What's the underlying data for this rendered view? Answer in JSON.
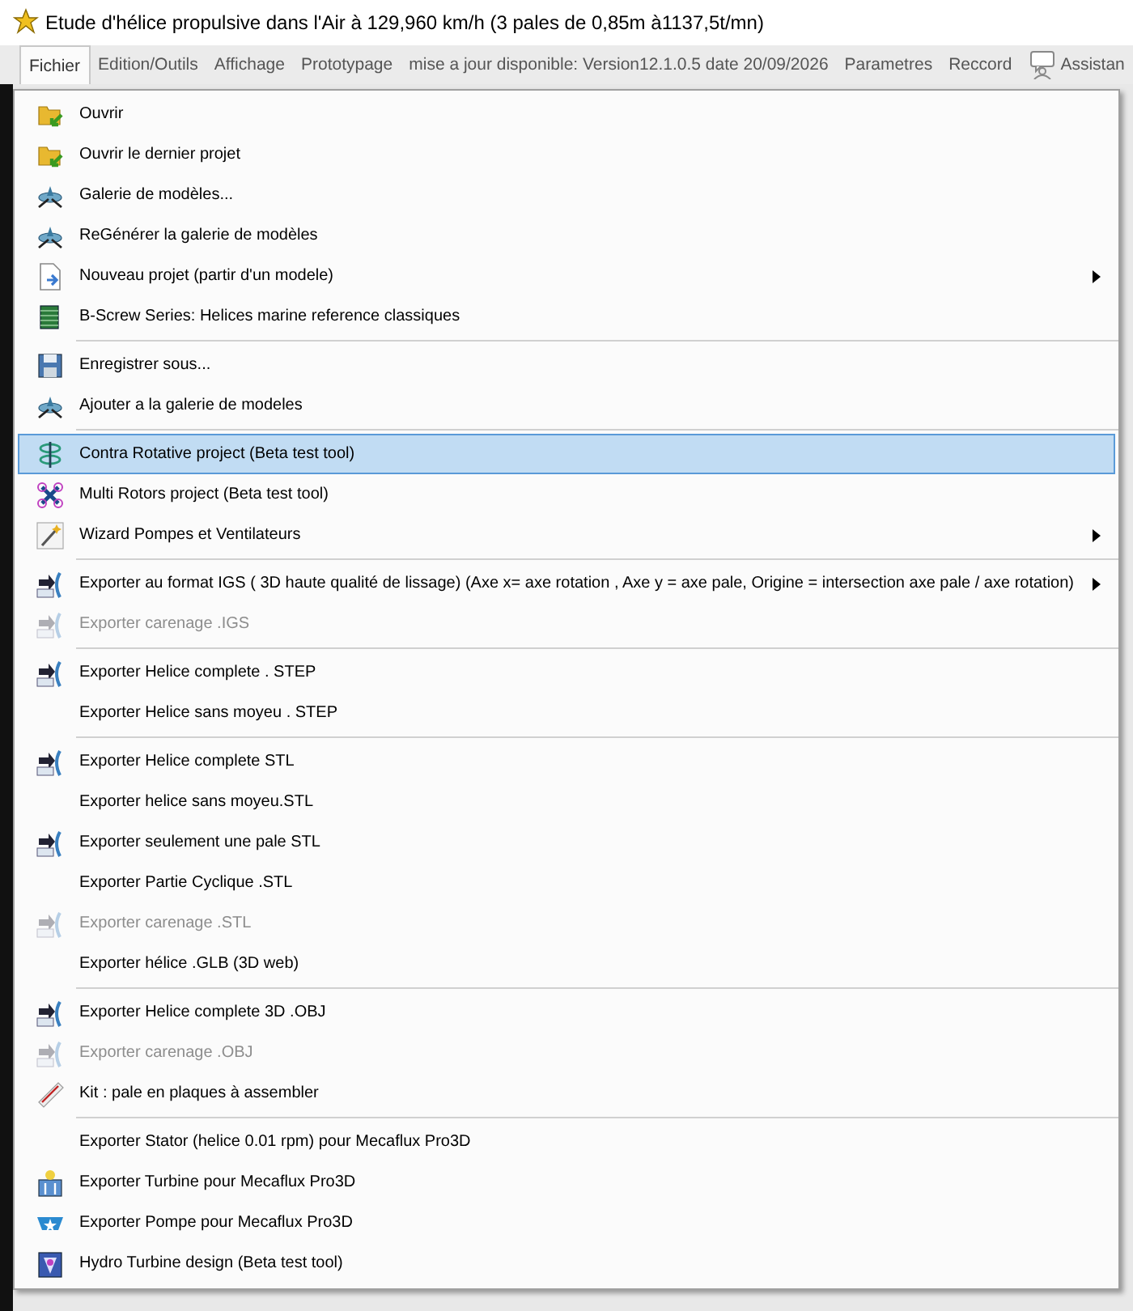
{
  "window": {
    "title": "Etude d'hélice propulsive dans l'Air à 129,960 km/h (3 pales de 0,85m à1137,5t/mn)"
  },
  "menubar": [
    {
      "label": "Fichier",
      "selected": true
    },
    {
      "label": "Edition/Outils",
      "selected": false
    },
    {
      "label": "Affichage",
      "selected": false
    },
    {
      "label": "Prototypage",
      "selected": false
    },
    {
      "label": "mise a jour disponible: Version12.1.0.5 date 20/09/2026",
      "selected": false
    },
    {
      "label": "Parametres",
      "selected": false
    },
    {
      "label": "Reccord",
      "selected": false
    },
    {
      "label": "Assistan",
      "selected": false,
      "kind": "assistant"
    }
  ],
  "menu": [
    {
      "kind": "item",
      "label": "Ouvrir",
      "disabled": false,
      "selected": false,
      "submenu": false
    },
    {
      "kind": "item",
      "label": "Ouvrir le dernier projet",
      "disabled": false,
      "selected": false,
      "submenu": false
    },
    {
      "kind": "item",
      "label": "Galerie de modèles...",
      "disabled": false,
      "selected": false,
      "submenu": false
    },
    {
      "kind": "item",
      "label": "ReGénérer la galerie de modèles",
      "disabled": false,
      "selected": false,
      "submenu": false
    },
    {
      "kind": "item",
      "label": "Nouveau projet (partir d'un modele)",
      "disabled": false,
      "selected": false,
      "submenu": true
    },
    {
      "kind": "item",
      "label": "B-Screw Series: Helices marine reference classiques",
      "disabled": false,
      "selected": false,
      "submenu": false
    },
    {
      "kind": "separator"
    },
    {
      "kind": "item",
      "label": "Enregistrer sous...",
      "disabled": false,
      "selected": false,
      "submenu": false
    },
    {
      "kind": "item",
      "label": "Ajouter a la galerie de modeles",
      "disabled": false,
      "selected": false,
      "submenu": false
    },
    {
      "kind": "separator"
    },
    {
      "kind": "item",
      "label": "Contra Rotative project (Beta test tool)",
      "disabled": false,
      "selected": true,
      "submenu": false
    },
    {
      "kind": "item",
      "label": "Multi Rotors project (Beta test tool)",
      "disabled": false,
      "selected": false,
      "submenu": false
    },
    {
      "kind": "item",
      "label": "Wizard Pompes et Ventilateurs",
      "disabled": false,
      "selected": false,
      "submenu": true
    },
    {
      "kind": "separator"
    },
    {
      "kind": "item",
      "label": "Exporter au format IGS ( 3D haute qualité de lissage) (Axe x= axe rotation , Axe y = axe pale, Origine = intersection axe pale / axe rotation)",
      "disabled": false,
      "selected": false,
      "submenu": true
    },
    {
      "kind": "item",
      "label": "Exporter carenage .IGS",
      "disabled": true,
      "selected": false,
      "submenu": false
    },
    {
      "kind": "separator"
    },
    {
      "kind": "item",
      "label": "Exporter Helice complete . STEP",
      "disabled": false,
      "selected": false,
      "submenu": false
    },
    {
      "kind": "item",
      "label": "Exporter Helice sans moyeu . STEP",
      "disabled": false,
      "selected": false,
      "submenu": false
    },
    {
      "kind": "separator"
    },
    {
      "kind": "item",
      "label": "Exporter Helice complete STL",
      "disabled": false,
      "selected": false,
      "submenu": false
    },
    {
      "kind": "item",
      "label": "Exporter helice sans moyeu.STL",
      "disabled": false,
      "selected": false,
      "submenu": false
    },
    {
      "kind": "item",
      "label": "Exporter seulement une pale STL",
      "disabled": false,
      "selected": false,
      "submenu": false
    },
    {
      "kind": "item",
      "label": "Exporter Partie Cyclique .STL",
      "disabled": false,
      "selected": false,
      "submenu": false
    },
    {
      "kind": "item",
      "label": "Exporter carenage .STL",
      "disabled": true,
      "selected": false,
      "submenu": false
    },
    {
      "kind": "item",
      "label": "Exporter hélice .GLB (3D web)",
      "disabled": false,
      "selected": false,
      "submenu": false
    },
    {
      "kind": "separator"
    },
    {
      "kind": "item",
      "label": "Exporter Helice complete 3D .OBJ",
      "disabled": false,
      "selected": false,
      "submenu": false
    },
    {
      "kind": "item",
      "label": "Exporter carenage .OBJ",
      "disabled": true,
      "selected": false,
      "submenu": false
    },
    {
      "kind": "item",
      "label": "Kit : pale en plaques à assembler",
      "disabled": false,
      "selected": false,
      "submenu": false
    },
    {
      "kind": "separator"
    },
    {
      "kind": "item",
      "label": "Exporter Stator (helice 0.01 rpm) pour Mecaflux Pro3D",
      "disabled": false,
      "selected": false,
      "submenu": false
    },
    {
      "kind": "item",
      "label": "Exporter Turbine pour Mecaflux Pro3D",
      "disabled": false,
      "selected": false,
      "submenu": false
    },
    {
      "kind": "item",
      "label": "Exporter Pompe pour Mecaflux Pro3D",
      "disabled": false,
      "selected": false,
      "submenu": false
    },
    {
      "kind": "item",
      "label": "Hydro Turbine design (Beta test tool)",
      "disabled": false,
      "selected": false,
      "submenu": false
    }
  ]
}
